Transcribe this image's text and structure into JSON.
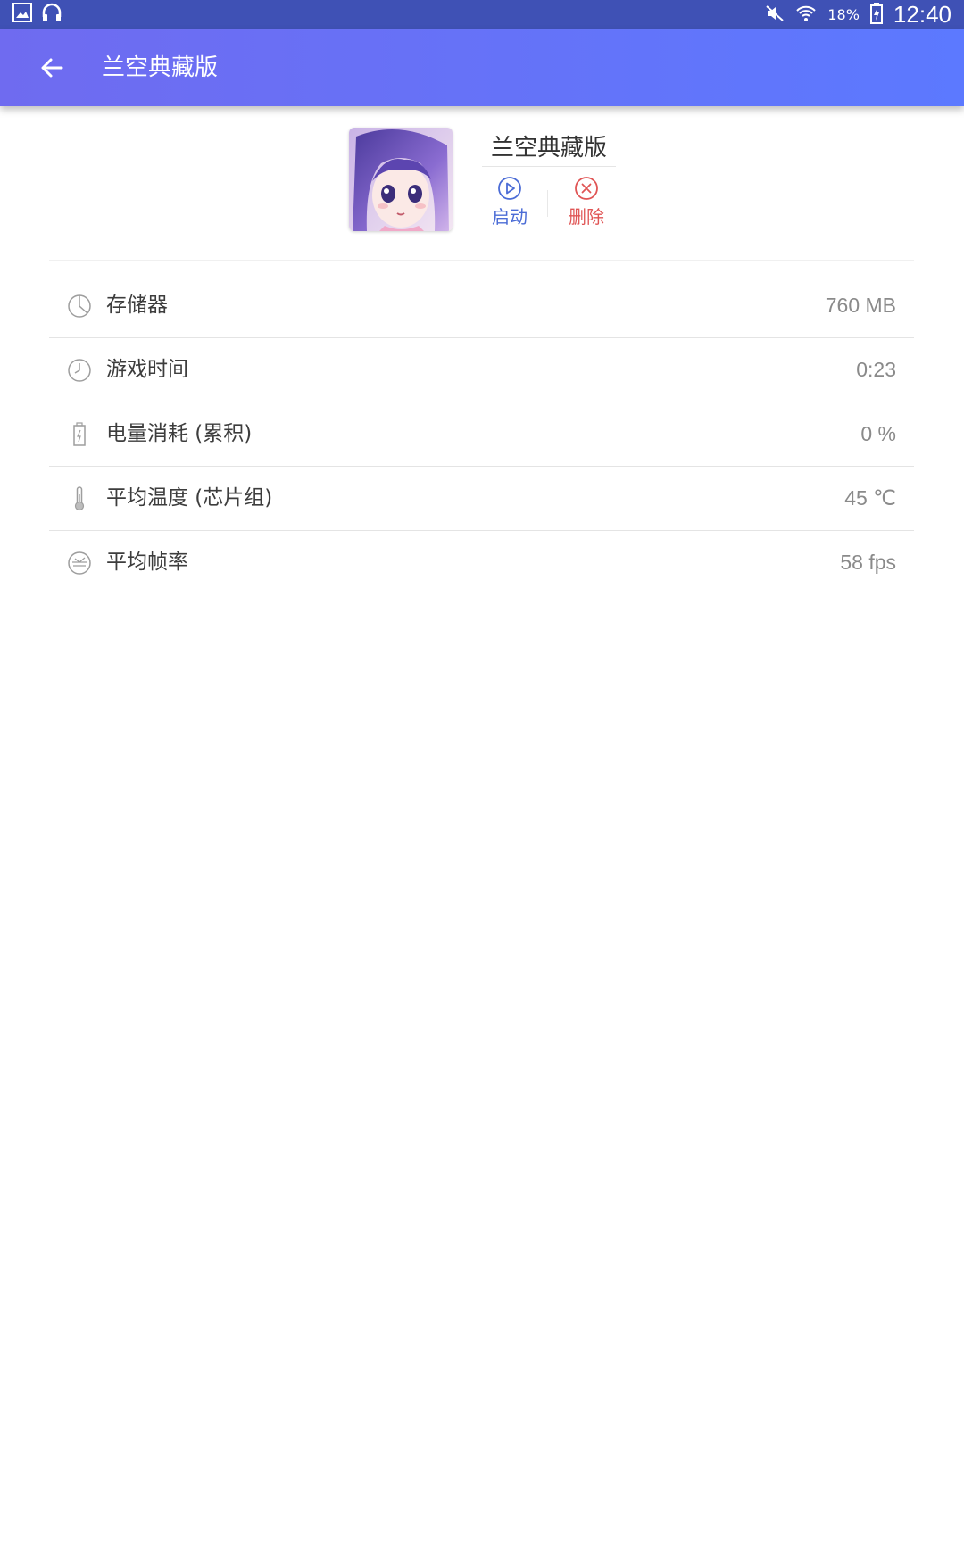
{
  "status_bar": {
    "battery_pct": "18%",
    "time": "12:40",
    "icons": [
      "gallery-icon",
      "headphones-icon",
      "mute-icon",
      "wifi-icon",
      "battery-charging-icon"
    ]
  },
  "app_bar": {
    "back_icon": "arrow-left-icon",
    "title": "兰空典藏版"
  },
  "app_card": {
    "name": "兰空典藏版",
    "launch_label": "启动",
    "delete_label": "删除",
    "colors": {
      "launch": "#4b6cd6",
      "delete": "#e05555"
    }
  },
  "stats": [
    {
      "icon": "pie-chart-icon",
      "label": "存储器",
      "value": "760 MB"
    },
    {
      "icon": "clock-icon",
      "label": "游戏时间",
      "value": "0:23"
    },
    {
      "icon": "battery-icon",
      "label": "电量消耗 (累积)",
      "value": "0 %"
    },
    {
      "icon": "thermometer-icon",
      "label": "平均温度 (芯片组)",
      "value": "45 ℃"
    },
    {
      "icon": "speedometer-icon",
      "label": "平均帧率",
      "value": "58 fps"
    }
  ],
  "theme": {
    "status_bar": "#3f51b5",
    "app_bar_start": "#6f6bf0",
    "app_bar_end": "#5c79ff"
  }
}
